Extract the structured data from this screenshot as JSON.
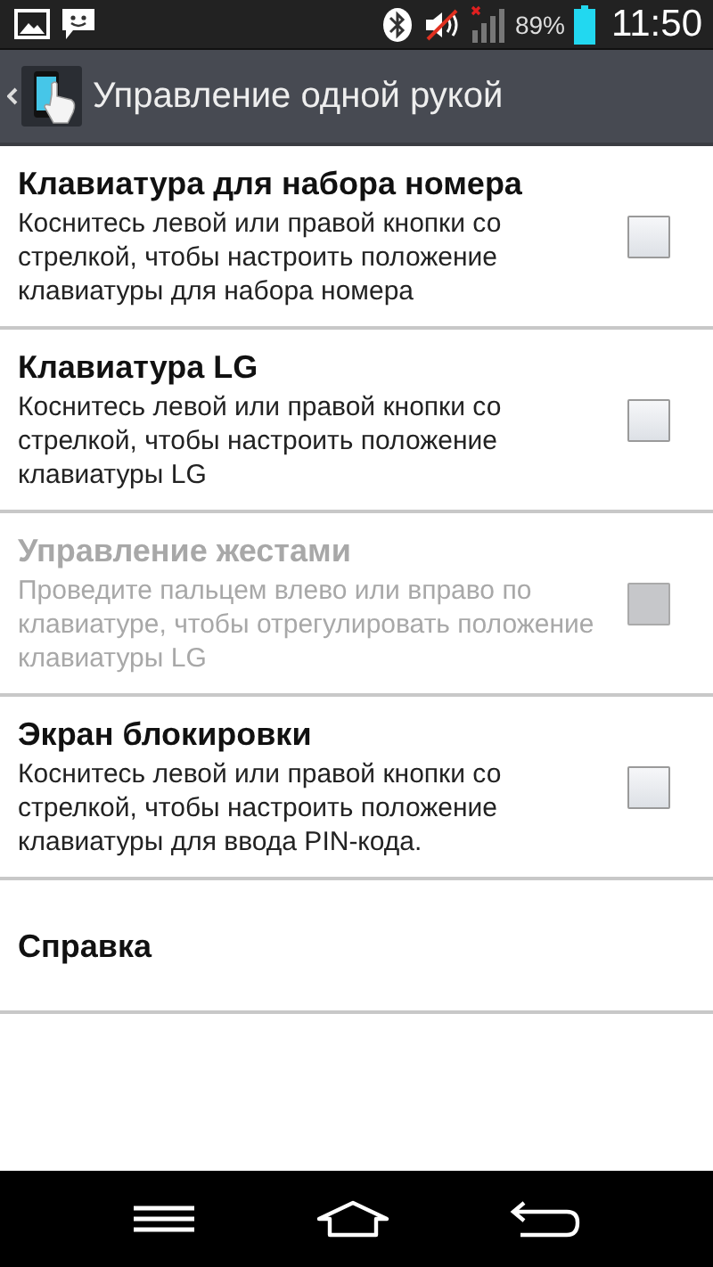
{
  "status_bar": {
    "battery_percent": "89%",
    "time": "11:50"
  },
  "action_bar": {
    "title": "Управление одной рукой"
  },
  "items": [
    {
      "kind": "checkbox",
      "title": "Клавиатура для набора номера",
      "summary": "Коснитесь левой или правой кнопки со стрелкой, чтобы настроить положение клавиатуры для набора номера",
      "checked": false,
      "disabled": false
    },
    {
      "kind": "checkbox",
      "title": "Клавиатура LG",
      "summary": "Коснитесь левой или правой кнопки со стрелкой, чтобы настроить положение клавиатуры LG",
      "checked": false,
      "disabled": false
    },
    {
      "kind": "checkbox",
      "title": "Управление жестами",
      "summary": "Проведите пальцем влево или вправо по клавиатуре, чтобы отрегулировать положение клавиатуры LG",
      "checked": false,
      "disabled": true
    },
    {
      "kind": "checkbox",
      "title": "Экран блокировки",
      "summary": "Коснитесь левой или правой кнопки со стрелкой, чтобы настроить положение клавиатуры для ввода PIN-кода.",
      "checked": false,
      "disabled": false
    },
    {
      "kind": "plain",
      "title": "Справка",
      "disabled": false
    }
  ]
}
